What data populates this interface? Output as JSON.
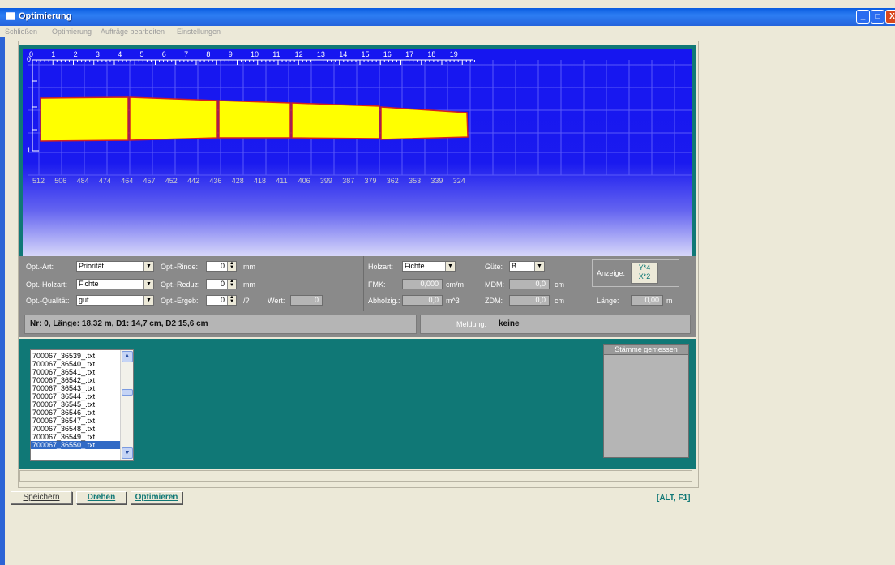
{
  "window": {
    "title": "Optimierung",
    "controls": [
      "_",
      "□",
      "X"
    ]
  },
  "menu": [
    "Schließen",
    "Optimierung",
    "Aufträge bearbeiten",
    "Einstellungen"
  ],
  "canvas": {
    "top_ticks": [
      "0",
      "1",
      "2",
      "3",
      "4",
      "5",
      "6",
      "7",
      "8",
      "9",
      "10",
      "11",
      "12",
      "13",
      "14",
      "15",
      "16",
      "17",
      "18",
      "19"
    ],
    "left_ticks": [
      "0",
      "1"
    ],
    "bottom_values": [
      "512",
      "506",
      "484",
      "474",
      "464",
      "457",
      "452",
      "442",
      "436",
      "428",
      "418",
      "411",
      "406",
      "399",
      "387",
      "379",
      "362",
      "353",
      "339",
      "324"
    ],
    "log_color": "#ffff00",
    "log_outline": "#d42020"
  },
  "controls": {
    "opt_art": {
      "label": "Opt.-Art:",
      "value": "Priorität"
    },
    "opt_holzart": {
      "label": "Opt.-Holzart:",
      "value": "Fichte"
    },
    "opt_qualitaet": {
      "label": "Opt.-Qualität:",
      "value": "gut"
    },
    "opt_rinde": {
      "label": "Opt.-Rinde:",
      "value": "0",
      "unit": "mm"
    },
    "opt_reduz": {
      "label": "Opt.-Reduz:",
      "value": "0",
      "unit": "mm"
    },
    "opt_ergeb": {
      "label": "Opt.-Ergeb:",
      "value": "0",
      "unit": "/?"
    },
    "wert": {
      "label": "Wert:",
      "value": "0"
    },
    "holzart": {
      "label": "Holzart:",
      "value": "Fichte"
    },
    "fmk": {
      "label": "FMK:",
      "value": "0,000",
      "unit": "cm/m"
    },
    "abholzig": {
      "label": "Abholzig.:",
      "value": "0,0",
      "unit": "m^3"
    },
    "guete": {
      "label": "Güte:",
      "value": "B"
    },
    "mdm": {
      "label": "MDM:",
      "value": "0,0",
      "unit": "cm"
    },
    "zdm": {
      "label": "ZDM:",
      "value": "0,0",
      "unit": "cm"
    },
    "anzeige": {
      "label": "Anzeige:",
      "btn_top": "Y*4",
      "btn_bottom": "X*2"
    },
    "laenge": {
      "label": "Länge:",
      "value": "0,00",
      "unit": "m"
    }
  },
  "info": {
    "text": "Nr: 0,  Länge: 18,32 m, D1: 14,7 cm,   D2 15,6 cm",
    "meldung_label": "Meldung:",
    "meldung_value": "keine"
  },
  "files": [
    "700067_36539_.txt",
    "700067_36540_.txt",
    "700067_36541_.txt",
    "700067_36542_.txt",
    "700067_36543_.txt",
    "700067_36544_.txt",
    "700067_36545_.txt",
    "700067_36546_.txt",
    "700067_36547_.txt",
    "700067_36548_.txt",
    "700067_36549_.txt",
    "700067_36550_.txt"
  ],
  "staemme": {
    "header": "Stämme gemessen"
  },
  "buttons": {
    "save": "Speichern",
    "rotate": "Drehen",
    "optimize": "Optimieren"
  },
  "shortcut": "[ALT, F1]"
}
